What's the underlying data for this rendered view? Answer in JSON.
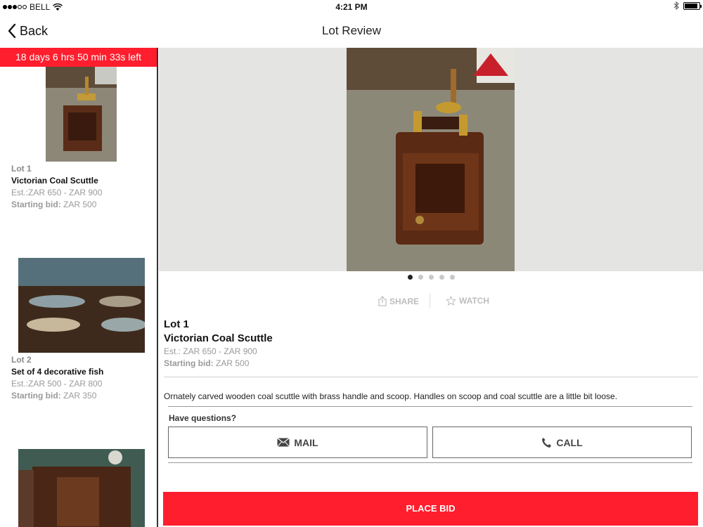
{
  "status_bar": {
    "carrier": "BELL",
    "time": "4:21 PM",
    "icons": [
      "signal-icon",
      "wifi-icon",
      "bluetooth-icon",
      "battery-icon"
    ]
  },
  "nav": {
    "back_label": "Back",
    "title": "Lot Review"
  },
  "sidebar": {
    "countdown": "18 days 6 hrs 50 min 33s left",
    "lots": [
      {
        "lot_label": "Lot 1",
        "title": "Victorian Coal Scuttle",
        "estimate": "Est.:ZAR 650 - ZAR 900",
        "starting_bid_label": "Starting bid:",
        "starting_bid_value": "ZAR 500"
      },
      {
        "lot_label": "Lot 2",
        "title": "Set of 4 decorative fish",
        "estimate": "Est.:ZAR 500 - ZAR 800",
        "starting_bid_label": "Starting bid:",
        "starting_bid_value": "ZAR 350"
      },
      {
        "lot_label": "",
        "title": "",
        "estimate": "",
        "starting_bid_label": "",
        "starting_bid_value": ""
      }
    ]
  },
  "main": {
    "pager": {
      "count": 5,
      "active_index": 0
    },
    "actions": {
      "share": "SHARE",
      "watch": "WATCH"
    },
    "lot_label": "Lot 1",
    "title": "Victorian Coal Scuttle",
    "estimate": "Est.: ZAR 650 - ZAR 900",
    "starting_bid_label": "Starting bid:",
    "starting_bid_value": "ZAR 500",
    "description": "Ornately carved wooden coal scuttle with brass handle and scoop. Handles on scoop and coal scuttle are a little bit loose.",
    "questions_label": "Have questions?",
    "mail_label": "MAIL",
    "call_label": "CALL",
    "place_bid_label": "PLACE BID"
  },
  "colors": {
    "accent_red": "#ff1e2d",
    "muted_text": "#9a9a9a",
    "hero_bg": "#e4e4e2"
  }
}
